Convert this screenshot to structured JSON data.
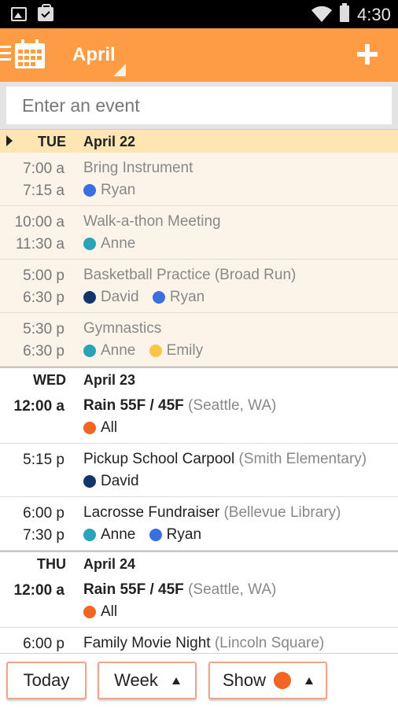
{
  "status_bar": {
    "time": "4:30"
  },
  "app_bar": {
    "month": "April"
  },
  "search": {
    "placeholder": "Enter an event"
  },
  "colors": {
    "accent": "#fe9c45",
    "ryan": "#3a6fe0",
    "anne": "#2aa3b8",
    "david": "#12356b",
    "emily": "#f7c548",
    "all": "#f26522"
  },
  "days": [
    {
      "dow": "TUE",
      "date": "April 22",
      "events": [
        {
          "t1": "7:00 a",
          "t2": "7:15 a",
          "name": "Bring Instrument",
          "loc": "",
          "people": [
            "Ryan"
          ]
        },
        {
          "t1": "10:00 a",
          "t2": "11:30 a",
          "name": "Walk-a-thon Meeting",
          "loc": "",
          "people": [
            "Anne"
          ]
        },
        {
          "t1": "5:00 p",
          "t2": "6:30 p",
          "name": "Basketball Practice",
          "loc": "(Broad Run)",
          "people": [
            "David",
            "Ryan"
          ]
        },
        {
          "t1": "5:30 p",
          "t2": "6:30 p",
          "name": "Gymnastics",
          "loc": "",
          "people": [
            "Anne",
            "Emily"
          ]
        }
      ]
    },
    {
      "dow": "WED",
      "date": "April 23",
      "events": [
        {
          "t1": "12:00 a",
          "t2": "",
          "name": "Rain 55F / 45F",
          "loc": "(Seattle, WA)",
          "people": [
            "All"
          ]
        },
        {
          "t1": "5:15 p",
          "t2": "",
          "name": "Pickup School Carpool",
          "loc": "(Smith Elementary)",
          "people": [
            "David"
          ]
        },
        {
          "t1": "6:00 p",
          "t2": "7:30 p",
          "name": "Lacrosse Fundraiser",
          "loc": "(Bellevue Library)",
          "people": [
            "Anne",
            "Ryan"
          ]
        }
      ]
    },
    {
      "dow": "THU",
      "date": "April 24",
      "events": [
        {
          "t1": "12:00 a",
          "t2": "",
          "name": "Rain 55F / 45F",
          "loc": "(Seattle, WA)",
          "people": [
            "All"
          ]
        },
        {
          "t1": "6:00 p",
          "t2": "",
          "name": "Family Movie Night",
          "loc": "(Lincoln Square)",
          "people": []
        }
      ]
    }
  ],
  "bottom_bar": {
    "today": "Today",
    "week": "Week",
    "show": "Show"
  }
}
